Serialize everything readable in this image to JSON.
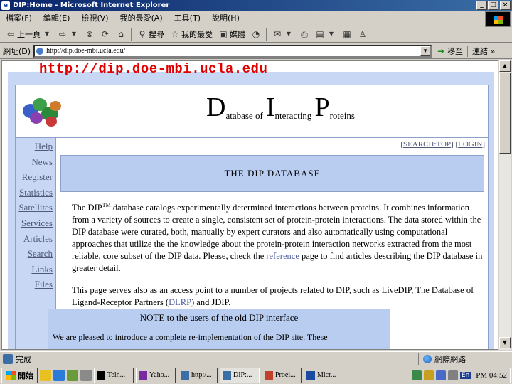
{
  "window": {
    "title": "DIP:Home - Microsoft Internet Explorer",
    "minimize_icon": "minimize-icon",
    "maximize_icon": "maximize-icon",
    "close_icon": "close-icon"
  },
  "menubar": {
    "items": [
      "檔案(F)",
      "編輯(E)",
      "檢視(V)",
      "我的最愛(A)",
      "工具(T)",
      "說明(H)"
    ]
  },
  "toolbar": {
    "back_label": "上一頁",
    "search_label": "搜尋",
    "favorites_label": "我的最愛",
    "media_label": "媒體"
  },
  "addressbar": {
    "label": "網址(D)",
    "url": "http://dip.doe-mbi.ucla.edu/",
    "go_label": "移至",
    "links_label": "連結"
  },
  "page": {
    "url_banner": "http://dip.doe-mbi.ucla.edu",
    "site_title": {
      "d": "D",
      "atabase_of": "atabase of",
      "i": "I",
      "nteracting": "nteracting",
      "p": "P",
      "roteins": "roteins"
    },
    "nav": [
      "Help",
      "News",
      "Register",
      "Statistics",
      "Satellites",
      "Services",
      "Articles",
      "Search",
      "Links",
      "Files"
    ],
    "top_links": {
      "search": "SEARCH:TOP",
      "login": "LOGIN"
    },
    "banner_title": "THE DIP DATABASE",
    "paragraph1": {
      "part1": "The DIP",
      "tm": "TM",
      "part2": " database catalogs experimentally determined interactions between proteins. It combines information from a variety of sources to create a single, consistent set of protein-protein interactions. The data stored within the DIP database were curated, both, manually by expert curators and also automatically using computational approaches that utilize the the knowledge about the protein-protein interaction networks extracted from the most reliable, core subset of the DIP data. Please, check the ",
      "link": "reference",
      "part3": " page to find articles describing the DIP database in greater detail."
    },
    "paragraph2": {
      "part1": "This page serves also as an access point to a number of projects related to DIP, such as LiveDIP, The Database of Ligand-Receptor Partners (",
      "link": "DLRP",
      "part2": ") and JDIP."
    },
    "note_title": "NOTE to the users of the old DIP interface",
    "note_text": "We are pleased to introduce a complete re-implementation of the DIP site. These"
  },
  "statusbar": {
    "text": "完成",
    "zone": "網際網路"
  },
  "taskbar": {
    "start_label": "開始",
    "tasks": [
      "Teln...",
      "Yaho...",
      "http:/...",
      "DIP:...",
      "Proei...",
      "Micr..."
    ],
    "active_index": 3,
    "tray_lang": "En",
    "clock": "PM 04:52"
  }
}
